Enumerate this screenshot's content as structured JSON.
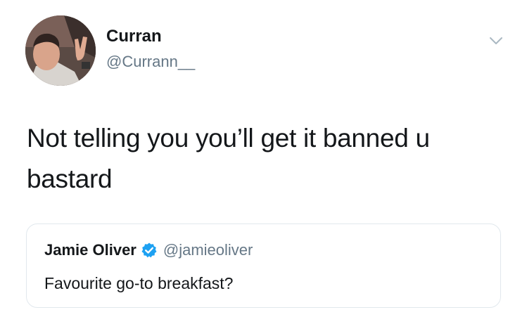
{
  "tweet": {
    "author_name": "Curran",
    "author_handle": "@Currann__",
    "text": "Not telling you you’ll get it banned u bastard",
    "menu_icon": "chevron-down-icon"
  },
  "quoted_tweet": {
    "author_name": "Jamie Oliver",
    "verified_icon": "verified-badge-icon",
    "author_handle": "@jamieoliver",
    "text": "Favourite go-to breakfast?"
  },
  "colors": {
    "text_primary": "#14171a",
    "text_secondary": "#657786",
    "verified_blue": "#1da1f2",
    "border": "#e1e8ed"
  }
}
